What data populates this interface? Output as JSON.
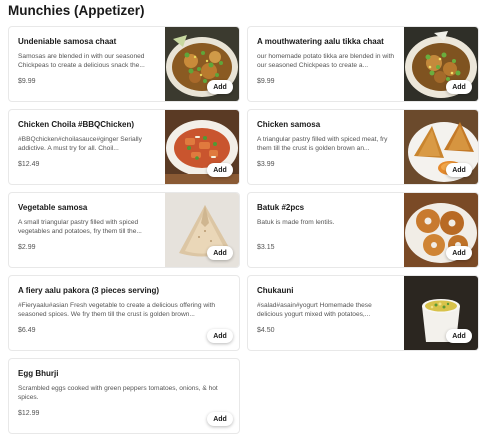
{
  "section": {
    "title": "Munchies (Appetizer)"
  },
  "items": [
    {
      "name": "Undeniable samosa chaat",
      "description": "Samosas are blended in with our seasoned Chickpeas to create a delicious snack the...",
      "price": "$9.99",
      "add_label": "Add",
      "image": "samosa-chaat-photo"
    },
    {
      "name": "A mouthwatering aalu tikka chaat",
      "description": "our homemade potato tikka are blended in with our seasoned Chickpeas to create a...",
      "price": "$9.99",
      "add_label": "Add",
      "image": "aalu-tikka-chaat-photo"
    },
    {
      "name": "Chicken Choila #BBQChicken)",
      "description": "#BBQchicken#choilasauce#ginger Serially addictive. A must try for all. Choil...",
      "price": "$12.49",
      "add_label": "Add",
      "image": "chicken-choila-photo"
    },
    {
      "name": "Chicken samosa",
      "description": "A triangular pastry filled with spiced meat, fry them till the crust is golden brown an...",
      "price": "$3.99",
      "add_label": "Add",
      "image": "chicken-samosa-photo"
    },
    {
      "name": "Vegetable samosa",
      "description": "A small triangular pastry filled with spiced vegetables and potatoes, fry them till the...",
      "price": "$2.99",
      "add_label": "Add",
      "image": "vegetable-samosa-photo"
    },
    {
      "name": "Batuk #2pcs",
      "description": "Batuk is made from lentils.",
      "price": "$3.15",
      "add_label": "Add",
      "image": "batuk-photo"
    },
    {
      "name": "A fiery aalu pakora (3 pieces serving)",
      "description": "#Fieryaalu#asian Fresh vegetable to create a delicious offering with seasoned spices. We fry them till the crust is golden brown...",
      "price": "$6.49",
      "add_label": "Add",
      "image": null
    },
    {
      "name": "Chukauni",
      "description": "#salad#asain#yogurt Homemade these delicious yogurt mixed with potatoes,...",
      "price": "$4.50",
      "add_label": "Add",
      "image": "chukauni-photo"
    },
    {
      "name": "Egg Bhurji",
      "description": "Scrambled eggs cooked with green peppers tomatoes, onions, & hot spices.",
      "price": "$12.99",
      "add_label": "Add",
      "image": null
    }
  ]
}
